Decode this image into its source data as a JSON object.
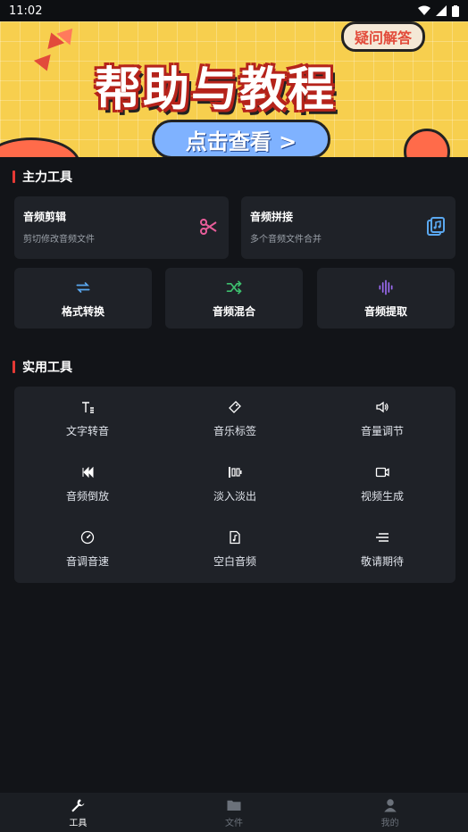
{
  "status": {
    "time": "11:02"
  },
  "banner": {
    "bubble_text": "疑问解答",
    "title": "帮助与教程",
    "cta": "点击查看 >"
  },
  "sections": {
    "main": "主力工具",
    "util": "实用工具"
  },
  "main_tools": {
    "audio_edit": {
      "name": "音频剪辑",
      "desc": "剪切修改音频文件"
    },
    "audio_join": {
      "name": "音频拼接",
      "desc": "多个音频文件合并"
    },
    "format_convert": "格式转换",
    "audio_mix": "音频混合",
    "audio_extract": "音频提取"
  },
  "util_tools": [
    {
      "label": "文字转音"
    },
    {
      "label": "音乐标签"
    },
    {
      "label": "音量调节"
    },
    {
      "label": "音频倒放"
    },
    {
      "label": "淡入淡出"
    },
    {
      "label": "视频生成"
    },
    {
      "label": "音调音速"
    },
    {
      "label": "空白音频"
    },
    {
      "label": "敬请期待"
    }
  ],
  "nav": {
    "tools": "工具",
    "files": "文件",
    "me": "我的"
  },
  "colors": {
    "background": "#121418",
    "card": "#1f2228",
    "accent_red": "#e53935",
    "pink_icon": "#e85d9a",
    "blue_icon": "#5aa8f0",
    "green_icon": "#3dbf6e",
    "purple_icon": "#9b6bf2"
  }
}
